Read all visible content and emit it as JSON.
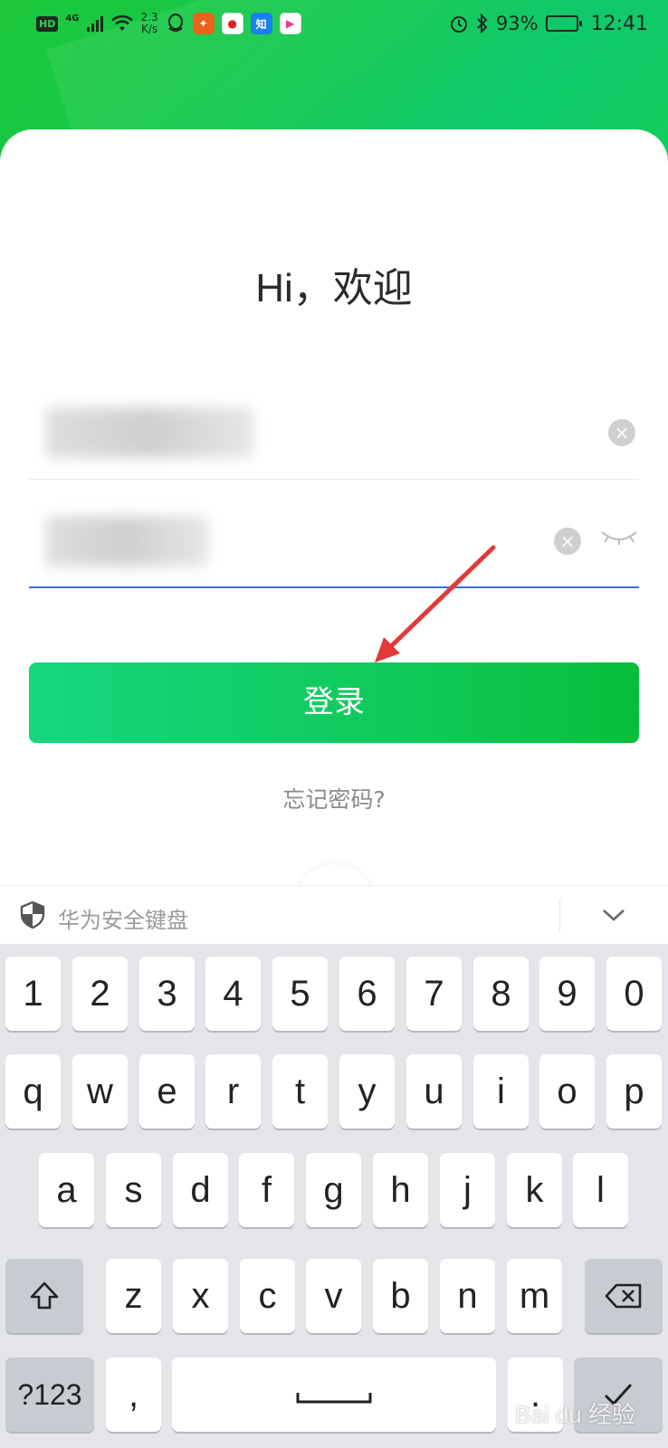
{
  "status_bar": {
    "hd": "HD",
    "network": "4G",
    "speed_value": "2.3",
    "speed_unit": "K/s",
    "battery": "93%",
    "time": "12:41",
    "apps": [
      "qq-icon",
      "game-icon",
      "toutiao-icon",
      "zhihu-icon",
      "video-icon"
    ]
  },
  "login": {
    "welcome": "Hi，欢迎",
    "login_button": "登录",
    "forgot_password": "忘记密码?"
  },
  "keyboard": {
    "title": "华为安全键盘",
    "row_numbers": [
      "1",
      "2",
      "3",
      "4",
      "5",
      "6",
      "7",
      "8",
      "9",
      "0"
    ],
    "row_top": [
      "q",
      "w",
      "e",
      "r",
      "t",
      "y",
      "u",
      "i",
      "o",
      "p"
    ],
    "row_middle": [
      "a",
      "s",
      "d",
      "f",
      "g",
      "h",
      "j",
      "k",
      "l"
    ],
    "row_bottom": [
      "z",
      "x",
      "c",
      "v",
      "b",
      "n",
      "m"
    ],
    "symbols_key": "?123",
    "comma_key": ","
  },
  "watermark": "Bai du 经验",
  "colors": {
    "brand_green": "#10c95a",
    "input_focus": "#3a6fd1",
    "annotation_arrow": "#e23a3a"
  }
}
